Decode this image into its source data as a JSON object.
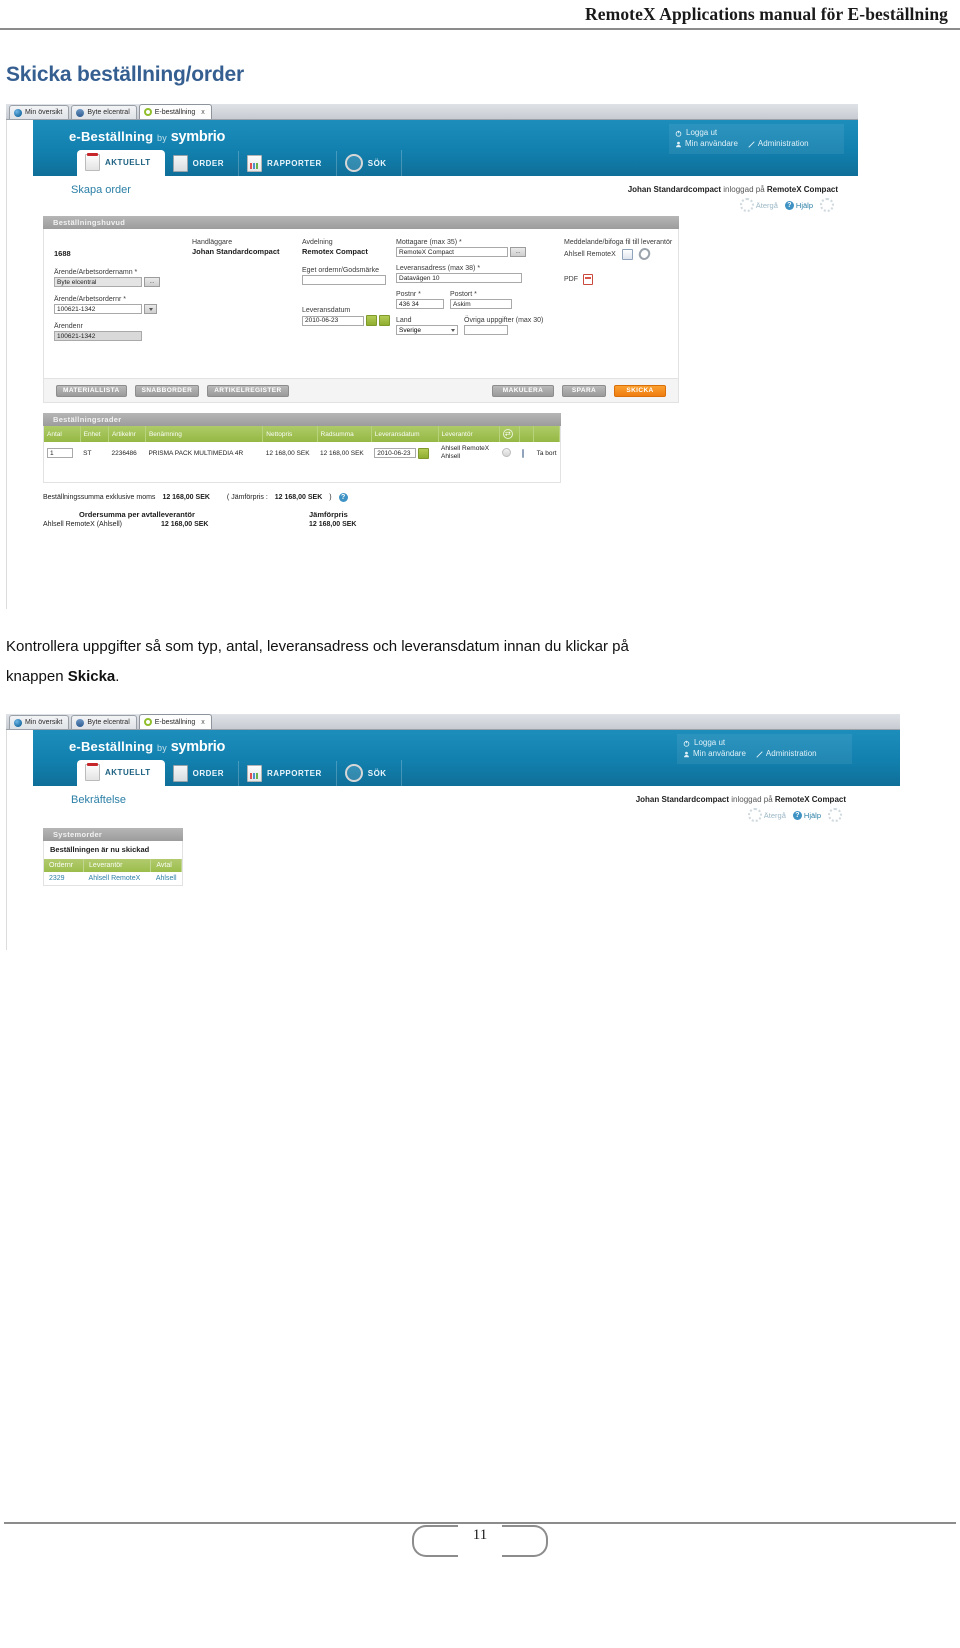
{
  "document": {
    "header_title": "RemoteX Applications manual för E-beställning",
    "section_heading": "Skicka beställning/order",
    "page_number": "11",
    "paragraph_line1": "Kontrollera uppgifter så som typ, antal, leveransadress och leveransdatum innan du klickar på",
    "paragraph_line2_prefix": "knappen ",
    "paragraph_line2_bold": "Skicka",
    "paragraph_line2_suffix": "."
  },
  "colors": {
    "heading_blue": "#365f91",
    "app_blue": "#1280ae",
    "table_green": "#95b844",
    "send_orange": "#ef7d10",
    "link_blue": "#2b7fa6"
  },
  "browser_tabs": [
    {
      "label": "Min översikt",
      "icon": "globe-icon",
      "active": false
    },
    {
      "label": "Byte elcentral",
      "icon": "document-icon",
      "active": false
    },
    {
      "label": "E-beställning",
      "icon": "ring-icon",
      "active": true,
      "close": "x"
    }
  ],
  "app": {
    "brand_main": "e-Beställning",
    "brand_by": "by",
    "brand_name": "symbrio",
    "user_menu": {
      "logout": "Logga ut",
      "my_users": "Min användare",
      "administration": "Administration"
    },
    "nav_tabs": [
      {
        "label": "AKTUELLT",
        "icon": "calendar-icon",
        "active": true
      },
      {
        "label": "ORDER",
        "icon": "clipboard-icon",
        "active": false
      },
      {
        "label": "RAPPORTER",
        "icon": "chart-icon",
        "active": false
      },
      {
        "label": "SÖK",
        "icon": "magnifier-icon",
        "active": false
      }
    ],
    "logged_in_user": "Johan Standardcompact",
    "logged_in_mid": " inloggad på ",
    "logged_in_system": "RemoteX Compact",
    "helpbar": {
      "back": "Ätergå",
      "help": "Hjälp"
    }
  },
  "screenshot1": {
    "page_title": "Skapa order",
    "panel_title": "Beställningshuvud",
    "order_id": "1688",
    "fields": {
      "handlaggare_label": "Handläggare",
      "handlaggare_value": "Johan Standardcompact",
      "avdelning_label": "Avdelning",
      "avdelning_value": "Remotex Compact",
      "arendenamn_label": "Ärende/Arbetsordernamn *",
      "arendenamn_value": "Byte elcentral",
      "arendenr_label": "Ärende/Arbetsordernr *",
      "arendenr_value": "100621-1342",
      "arendenr2_label": "Ärendenr",
      "arendenr2_value": "100621-1342",
      "egetordernr_label": "Eget ordernr/Godsmärke",
      "egetordernr_value": "",
      "leveransdatum_label": "Leveransdatum",
      "leveransdatum_value": "2010-06-23",
      "mottagare_label": "Mottagare (max 35) *",
      "mottagare_value": "RemoteX Compact",
      "leveransadress_label": "Leveransadress (max 38) *",
      "leveransadress_value": "Datavägen 10",
      "postnr_label": "Postnr *",
      "postnr_value": "436 34",
      "postort_label": "Postort *",
      "postort_value": "Askim",
      "land_label": "Land",
      "land_value": "Sverige",
      "ovriga_label": "Övriga uppgifter (max 30)",
      "ovriga_value": "",
      "meddelande_label": "Meddelande/bifoga fil till leverantör",
      "meddelande_supplier": "Ahlsell RemoteX",
      "pdf_label": "PDF"
    },
    "buttons": {
      "materiallista": "MATERIALLISTA",
      "snabborder": "SNABBORDER",
      "artikelregister": "ARTIKELREGISTER",
      "makulera": "MAKULERA",
      "spara": "SPARA",
      "skicka": "SKICKA"
    },
    "lines_panel_title": "Beställningsrader",
    "lines_columns": [
      "Antal",
      "Enhet",
      "Artikelnr",
      "Benämning",
      "Nettopris",
      "Radsumma",
      "Leveransdatum",
      "Leverantör",
      "",
      "",
      ""
    ],
    "lines_rows": [
      {
        "antal": "1",
        "enhet": "ST",
        "artikelnr": "2236486",
        "benamning": "PRISMA PACK MULTIMEDIA 4R",
        "nettopris": "12 168,00 SEK",
        "radsumma": "12 168,00 SEK",
        "leveransdatum": "2010-06-23",
        "leverantor_line1": "Ahlsell RemoteX",
        "leverantor_line2": "Ahlsell",
        "remove": "Ta bort"
      }
    ],
    "totals": {
      "sum_label": "Beställningssumma exklusive moms",
      "sum_value": "12 168,00 SEK",
      "compare_label": "( Jämförpris :",
      "compare_value": "12 168,00 SEK",
      "compare_close": ")",
      "col1_head": "Ordersumma per avtalleverantör",
      "col2_head": "Jämförpris",
      "row_supplier": "Ahlsell RemoteX (Ahlsell)",
      "row_sum": "12 168,00 SEK",
      "row_compare": "12 168,00 SEK"
    }
  },
  "screenshot2": {
    "page_title": "Bekräftelse",
    "panel_title": "Systemorder",
    "message": "Beställningen är nu skickad",
    "columns": [
      "Ordernr",
      "Leverantör",
      "Avtal"
    ],
    "rows": [
      {
        "ordernr": "2329",
        "leverantor": "Ahlsell RemoteX",
        "avtal": "Ahlsell"
      }
    ]
  }
}
